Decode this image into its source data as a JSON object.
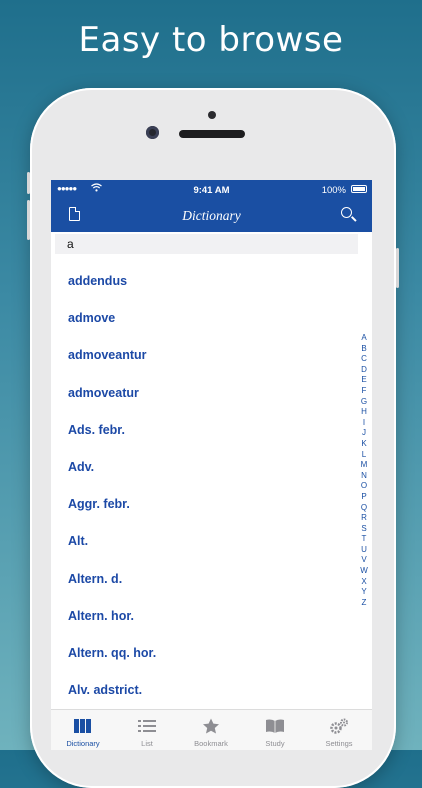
{
  "headline": "Easy to browse",
  "status_bar": {
    "signal": "●●●●●",
    "time": "9:41 AM",
    "battery": "100%"
  },
  "nav": {
    "title": "Dictionary",
    "left_icon": "document-icon",
    "right_icon": "search-icon"
  },
  "search": {
    "value": "a"
  },
  "words": [
    "addendus",
    "admove",
    "admoveantur",
    "admoveatur",
    "Ads. febr.",
    "Adv.",
    "Aggr. febr.",
    "Alt.",
    "Altern. d.",
    "Altern. hor.",
    "Altern. qq. hor.",
    "Alv. adstrict."
  ],
  "index_letters": [
    "A",
    "B",
    "C",
    "D",
    "E",
    "F",
    "G",
    "H",
    "I",
    "J",
    "K",
    "L",
    "M",
    "N",
    "O",
    "P",
    "Q",
    "R",
    "S",
    "T",
    "U",
    "V",
    "W",
    "X",
    "Y",
    "Z"
  ],
  "tabs": [
    {
      "label": "Dictionary",
      "icon": "books-icon",
      "active": true
    },
    {
      "label": "List",
      "icon": "list-icon",
      "active": false
    },
    {
      "label": "Bookmark",
      "icon": "star-icon",
      "active": false
    },
    {
      "label": "Study",
      "icon": "open-book-icon",
      "active": false
    },
    {
      "label": "Settings",
      "icon": "gears-icon",
      "active": false
    }
  ],
  "colors": {
    "accent": "#1a4fa3",
    "word": "#1c49a6",
    "tab_inactive": "#8e8e93"
  }
}
